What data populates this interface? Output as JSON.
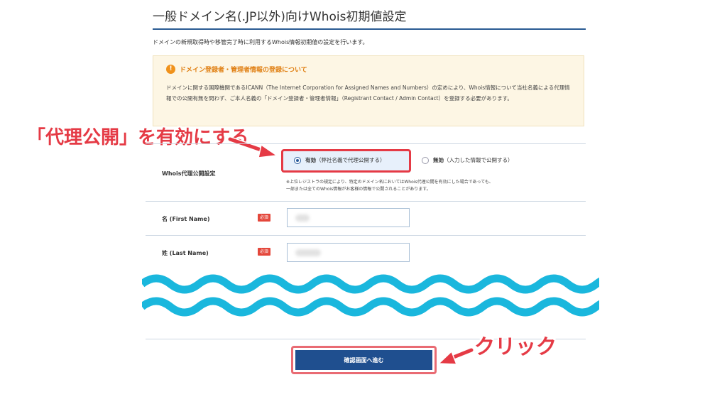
{
  "header": {
    "title": "一般ドメイン名(.JP以外)向けWhois初期値設定",
    "description": "ドメインの新規取得時や移管完了時に利用するWhois情報初期値の設定を行います。"
  },
  "notice": {
    "title": "ドメイン登録者・管理者情報の登録について",
    "body": "ドメインに関する国際機関であるICANN（The Internet Corporation for Assigned Names and Numbers）の定めにより、Whois情報について当社名義による代理情報での公開有無を問わず、ご本人名義の「ドメイン登録者・管理者情報」（Registrant Contact / Admin Contact）を登録する必要があります。",
    "icon": "exclamation-circle-icon",
    "accent": "#e07f12"
  },
  "annotations": {
    "proxy_enable": "「代理公開」を有効にする",
    "click": "クリック",
    "color": "#e53a45"
  },
  "whois_proxy": {
    "label": "Whois代理公開設定",
    "option_enabled": {
      "bold": "有効",
      "detail": "（弊社名義で代理公開する）",
      "checked": true
    },
    "option_disabled": {
      "bold": "無効",
      "detail": "（入力した情報で公開する）",
      "checked": false
    },
    "note_line1": "※上位レジストラの規定により、特定のドメイン名においてはWhois代理公開を有効にした場合であっても、",
    "note_line2": "一部または全てのWhois情報がお客様の情報で公開されることがあります。"
  },
  "fields": {
    "first_name": {
      "label": "名 (First Name)",
      "required": "必須"
    },
    "last_name": {
      "label": "姓 (Last Name)",
      "required": "必須"
    }
  },
  "submit": {
    "label": "確認画面へ進む",
    "color": "#1f4f8f"
  }
}
